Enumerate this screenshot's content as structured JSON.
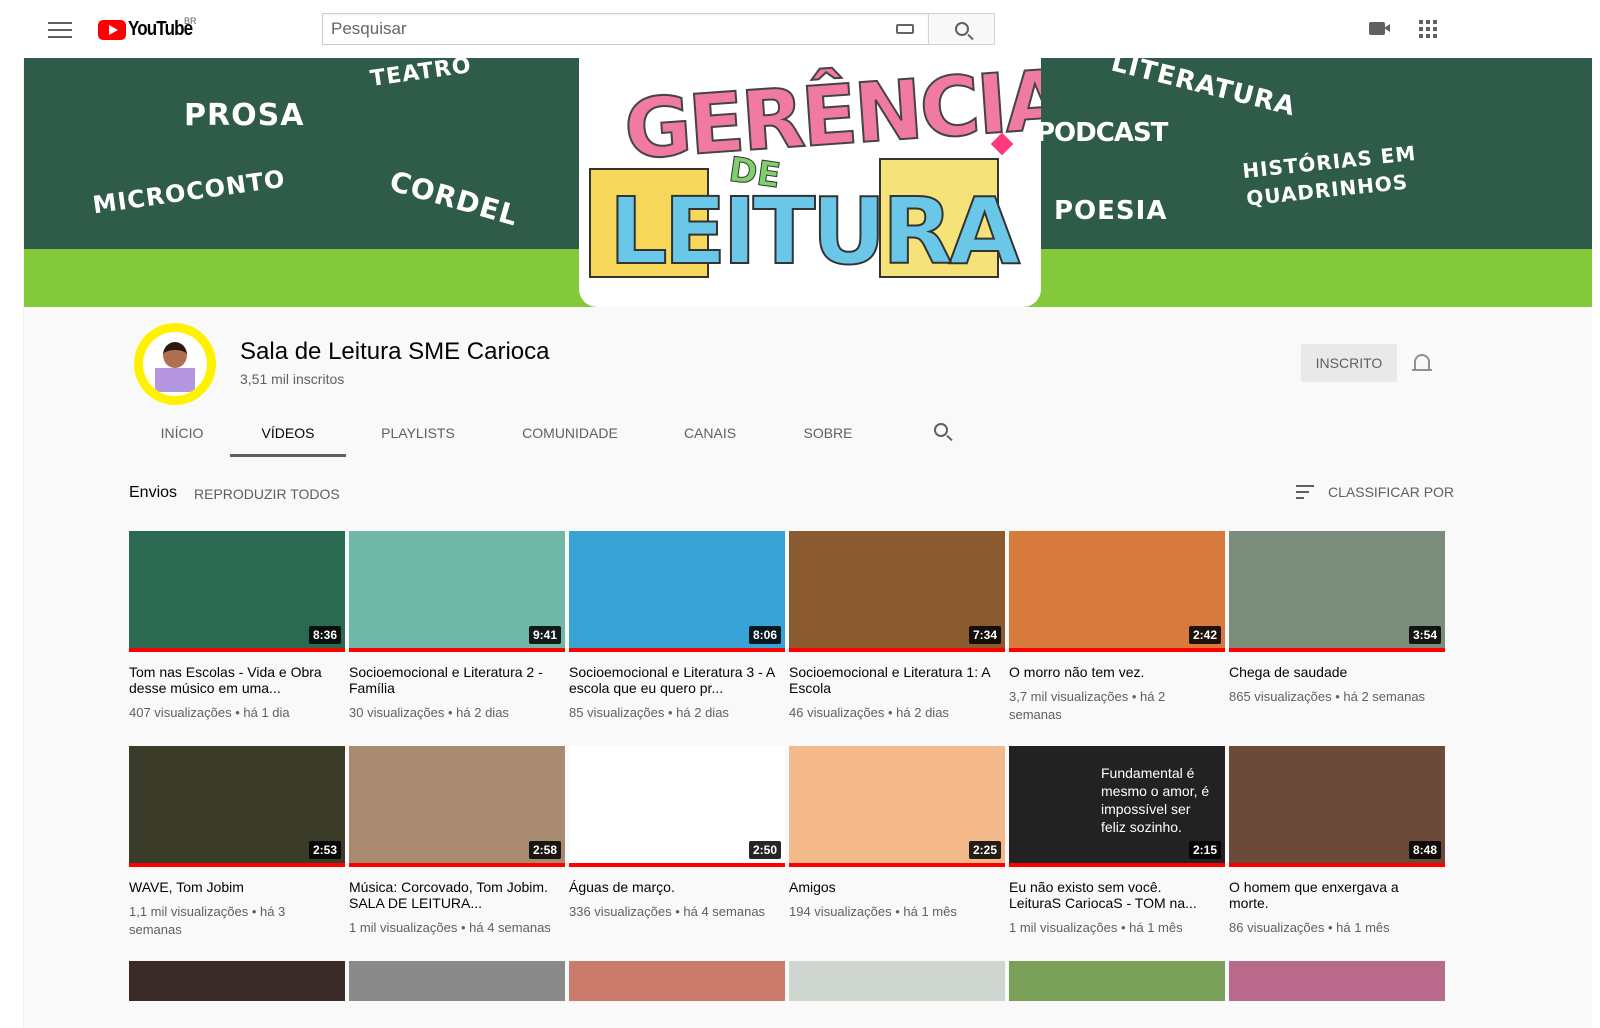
{
  "masthead": {
    "logo_text": "YouTube",
    "country": "BR",
    "search_placeholder": "Pesquisar"
  },
  "banner": {
    "words_left": [
      "PROSA",
      "TEATRO",
      "MICROCONTO",
      "CORDEL"
    ],
    "words_right": [
      "LITERATURA",
      "PODCAST",
      "HISTÓRIAS EM",
      "QUADRINHOS",
      "POESIA"
    ],
    "art_title_1": "GERÊNCIA",
    "art_title_2": "DE",
    "art_title_3": "LEITURA",
    "colors": {
      "dark": "#2f5c48",
      "light": "#84c83c"
    }
  },
  "channel": {
    "name": "Sala de Leitura SME Carioca",
    "subscribers": "3,51 mil inscritos",
    "subscribe_label": "INSCRITO",
    "tabs": [
      "INÍCIO",
      "VÍDEOS",
      "PLAYLISTS",
      "COMUNIDADE",
      "CANAIS",
      "SOBRE"
    ],
    "active_tab": "VÍDEOS"
  },
  "section": {
    "title": "Envios",
    "play_all": "REPRODUZIR TODOS",
    "sort": "CLASSIFICAR POR"
  },
  "videos": [
    {
      "title": "Tom nas Escolas - Vida e Obra desse músico em uma...",
      "duration": "8:36",
      "meta": "407 visualizações • há 1 dia",
      "bg": "#2a6a52"
    },
    {
      "title": "Socioemocional e Literatura 2 - Família",
      "duration": "9:41",
      "meta": "30 visualizações • há 2 dias",
      "bg": "#6fb7a6"
    },
    {
      "title": "Socioemocional e Literatura 3 - A escola que eu quero pr...",
      "duration": "8:06",
      "meta": "85 visualizações • há 2 dias",
      "bg": "#3aa3d6"
    },
    {
      "title": "Socioemocional e Literatura 1: A Escola",
      "duration": "7:34",
      "meta": "46 visualizações • há 2 dias",
      "bg": "#8a5a30"
    },
    {
      "title": "O morro não tem vez.",
      "duration": "2:42",
      "meta": "3,7 mil visualizações • há 2 semanas",
      "bg": "#d77a3d"
    },
    {
      "title": "Chega de saudade",
      "duration": "3:54",
      "meta": "865 visualizações • há 2 semanas",
      "bg": "#7a8c7a"
    },
    {
      "title": "WAVE, Tom Jobim",
      "duration": "2:53",
      "meta": "1,1 mil visualizações • há 3 semanas",
      "bg": "#3b3b2a"
    },
    {
      "title": "Música: Corcovado, Tom Jobim. SALA DE LEITURA...",
      "duration": "2:58",
      "meta": "1 mil visualizações • há 4 semanas",
      "bg": "#a88a70"
    },
    {
      "title": "Águas de março.",
      "duration": "2:50",
      "meta": "336 visualizações • há 4 semanas",
      "bg": "#ffffff"
    },
    {
      "title": "Amigos",
      "duration": "2:25",
      "meta": "194 visualizações • há 1 mês",
      "bg": "#f4b98a"
    },
    {
      "title": "Eu não existo sem você. LeituraS CariocaS - TOM na...",
      "duration": "2:15",
      "meta": "1 mil visualizações • há 1 mês",
      "bg": "#222222",
      "overlay": "Fundamental é mesmo o amor, é impossível ser feliz sozinho."
    },
    {
      "title": "O homem que enxergava a morte.",
      "duration": "8:48",
      "meta": "86 visualizações • há 1 mês",
      "bg": "#6b4a3a"
    }
  ],
  "row3_colors": [
    "#3a2a28",
    "#8a8a8a",
    "#c97a6a",
    "#cfd6d0",
    "#7aa05a",
    "#b96a8a",
    "#e8e8ee"
  ]
}
